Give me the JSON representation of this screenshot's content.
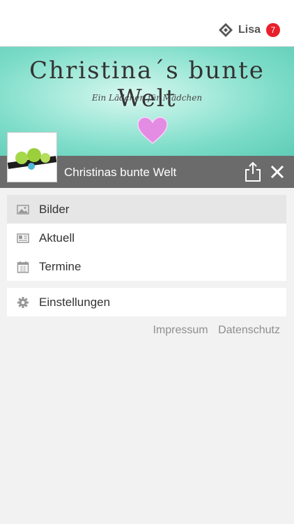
{
  "header": {
    "user_name": "Lisa",
    "notification_count": "7",
    "badge_color": "#e8202a"
  },
  "banner": {
    "title": "Christina´s bunte Welt",
    "subtitle": "Ein Lädchen für Mädchen",
    "accent": "#7cdcc8"
  },
  "page": {
    "title": "Christinas bunte Welt"
  },
  "menu": {
    "items": [
      {
        "label": "Bilder",
        "icon": "image-icon",
        "active": true
      },
      {
        "label": "Aktuell",
        "icon": "newspaper-icon"
      },
      {
        "label": "Termine",
        "icon": "calendar-icon"
      }
    ]
  },
  "settings": {
    "label": "Einstellungen",
    "icon": "gear-icon"
  },
  "footer": {
    "impressum": "Impressum",
    "datenschutz": "Datenschutz"
  }
}
